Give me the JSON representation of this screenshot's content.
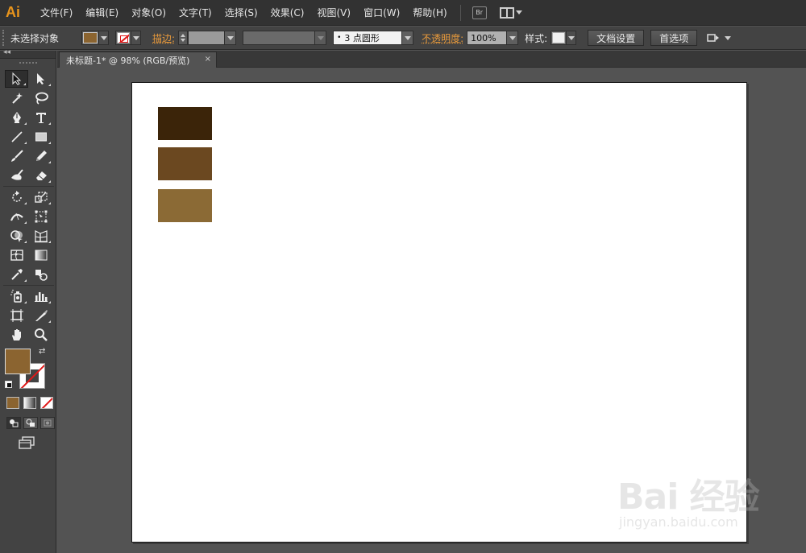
{
  "app": {
    "logo": "Ai"
  },
  "menu": [
    "文件(F)",
    "编辑(E)",
    "对象(O)",
    "文字(T)",
    "选择(S)",
    "效果(C)",
    "视图(V)",
    "窗口(W)",
    "帮助(H)"
  ],
  "menubar_extras": {
    "bridge_label": "Br"
  },
  "control": {
    "selection_label": "未选择对象",
    "stroke_label": "描边:",
    "brush_value": "3 点圆形",
    "opacity_label": "不透明度:",
    "opacity_value": "100%",
    "style_label": "样式:",
    "doc_setup_button": "文档设置",
    "preferences_button": "首选项"
  },
  "document": {
    "tab_title": "未标题-1* @ 98% (RGB/预览)",
    "close_glyph": "×"
  },
  "tools_panel": {
    "collapse_glyph": "◂◂",
    "swap_glyph": "⇄",
    "tools": [
      "selection-tool",
      "direct-selection-tool",
      "magic-wand-tool",
      "lasso-tool",
      "pen-tool",
      "type-tool",
      "line-segment-tool",
      "rectangle-tool",
      "paintbrush-tool",
      "pencil-tool",
      "blob-brush-tool",
      "eraser-tool",
      "rotate-tool",
      "scale-tool",
      "width-tool",
      "free-transform-tool",
      "shape-builder-tool",
      "perspective-grid-tool",
      "mesh-tool",
      "gradient-tool",
      "eyedropper-tool",
      "blend-tool",
      "symbol-sprayer-tool",
      "column-graph-tool",
      "artboard-tool",
      "slice-tool",
      "hand-tool",
      "zoom-tool"
    ]
  },
  "colors": {
    "fill": "#8b6430",
    "swatch_dark": "#3b2409",
    "swatch_medium": "#6b4820",
    "swatch_light": "#8b6a35",
    "accent_orange": "#e8941c"
  },
  "canvas": {
    "rectangles": [
      {
        "name": "dark-brown-rectangle",
        "color": "#3b2409"
      },
      {
        "name": "medium-brown-rectangle",
        "color": "#6b4820"
      },
      {
        "name": "light-brown-rectangle",
        "color": "#8b6a35"
      }
    ]
  },
  "watermark": {
    "main": "Bai 经验",
    "sub": "jingyan.baidu.com"
  }
}
